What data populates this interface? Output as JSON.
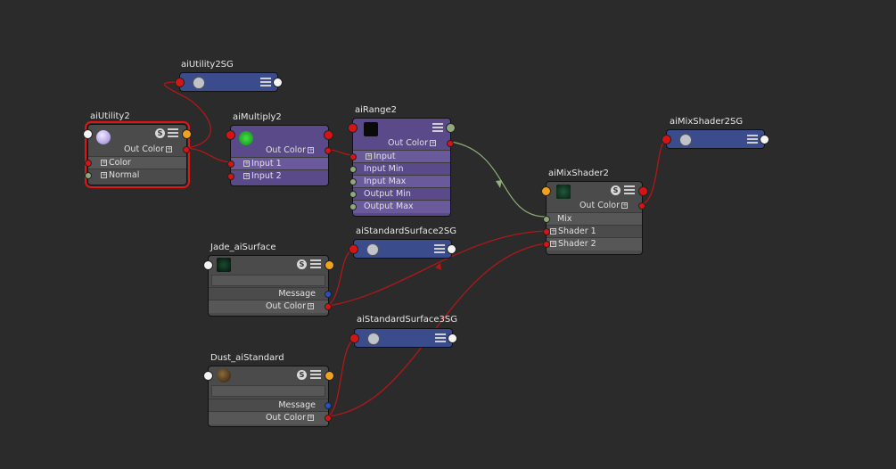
{
  "colors": {
    "background": "#2b2b2b",
    "wire": "#b01818",
    "wire_green": "#8fb07a",
    "selected": "#e01515"
  },
  "nodes": {
    "aiUtility2SG": {
      "title": "aiUtility2SG"
    },
    "aiUtility2": {
      "title": "aiUtility2",
      "out_color": "Out Color",
      "color": "Color",
      "normal": "Normal"
    },
    "aiMultiply2": {
      "title": "aiMultiply2",
      "out_color": "Out Color",
      "input1": "Input 1",
      "input2": "Input 2"
    },
    "aiRange2": {
      "title": "aiRange2",
      "out_color": "Out Color",
      "input": "Input",
      "input_min": "Input Min",
      "input_max": "Input Max",
      "output_min": "Output Min",
      "output_max": "Output Max"
    },
    "aiMixShader2SG": {
      "title": "aiMixShader2SG"
    },
    "aiMixShader2": {
      "title": "aiMixShader2",
      "out_color": "Out Color",
      "mix": "Mix",
      "shader1": "Shader 1",
      "shader2": "Shader 2"
    },
    "aiStandardSurface2SG": {
      "title": "aiStandardSurface2SG"
    },
    "jade": {
      "title": "Jade_aiSurface",
      "message": "Message",
      "out_color": "Out Color"
    },
    "aiStandardSurface3SG": {
      "title": "aiStandardSurface3SG"
    },
    "dust": {
      "title": "Dust_aiStandard",
      "message": "Message",
      "out_color": "Out Color"
    }
  },
  "icons": {
    "swatch": "swatch-icon",
    "solo": "s-icon",
    "list": "list-icon",
    "shading_group": "shading-group-icon"
  },
  "badge_letter": "S"
}
